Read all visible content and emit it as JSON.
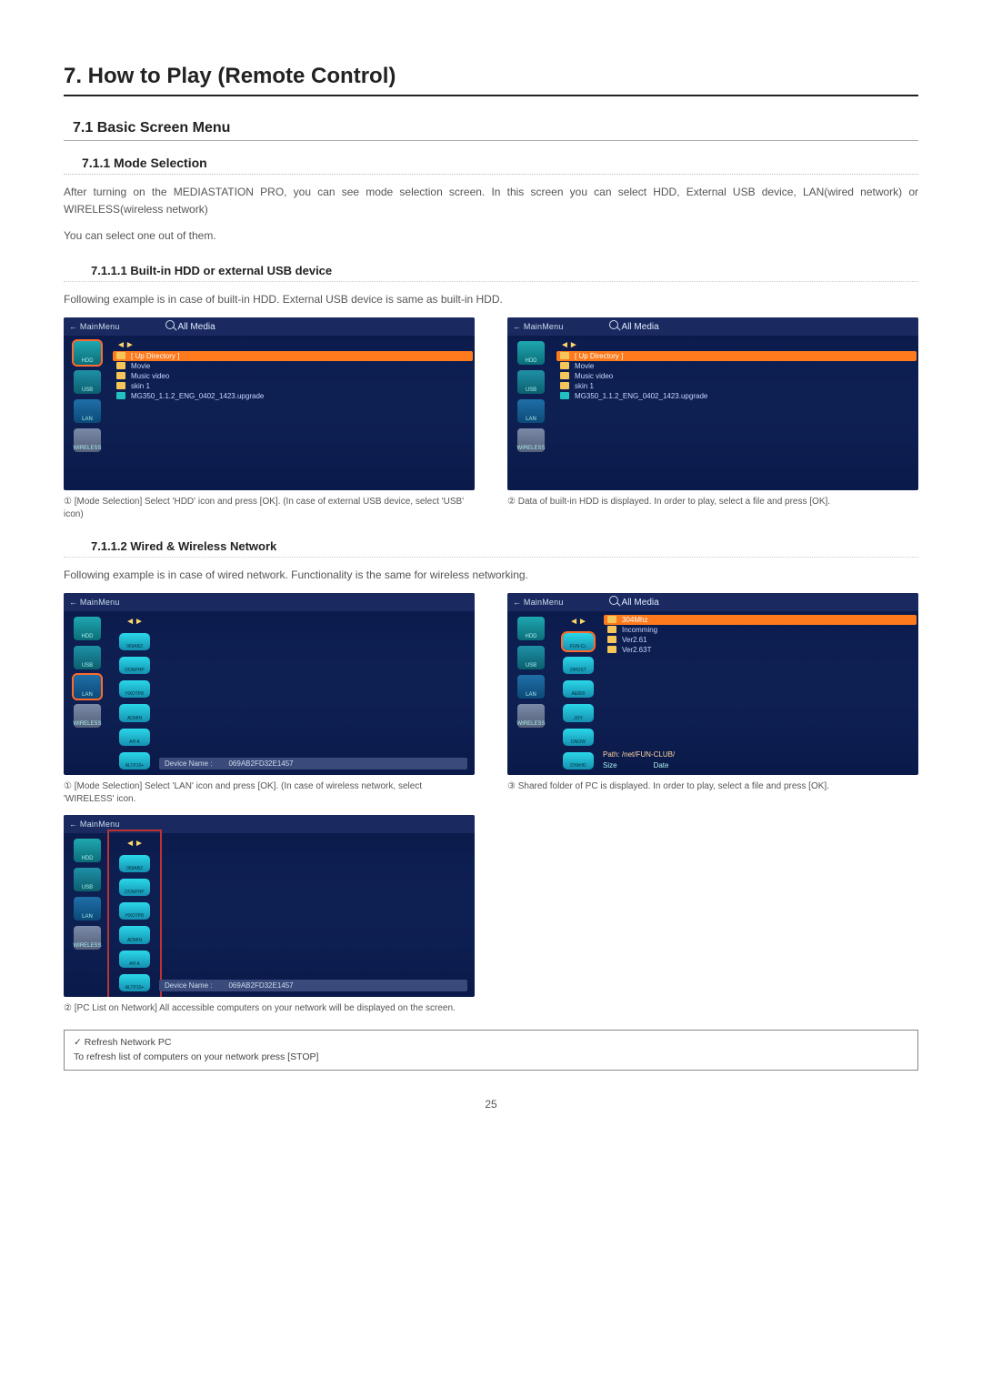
{
  "page_number": "25",
  "chapter_title": "7. How to Play (Remote Control)",
  "section_7_1": "7.1 Basic Screen Menu",
  "section_7_1_1": "7.1.1 Mode Selection",
  "para_7_1_1_a": "After turning on the MEDIASTATION PRO, you can see mode selection screen. In this screen you can select HDD, External USB device, LAN(wired network) or WIRELESS(wireless network)",
  "para_7_1_1_b": "You can select one out of them.",
  "section_7_1_1_1": "7.1.1.1 Built-in HDD or external USB device",
  "para_7_1_1_1": "Following example is in case of built-in HDD. External USB device is same as built-in HDD.",
  "section_7_1_1_2": "7.1.1.2 Wired & Wireless Network",
  "para_7_1_1_2": "Following example is in case of wired network. Functionality is the same for wireless networking.",
  "captions": {
    "hdd_1": "① [Mode Selection] Select 'HDD' icon and press [OK]. (In case of external USB device, select 'USB' icon)",
    "hdd_2": "② Data of built-in HDD is displayed. In order to play, select a file and press [OK].",
    "net_1": "① [Mode Selection] Select 'LAN' icon and press [OK]. (In case of wireless network, select 'WIRELESS' icon.",
    "net_2": "② [PC List on Network] All accessible computers on your network will be displayed on the screen.",
    "net_3": "③ Shared folder of PC is displayed. In order to play, select a file and press [OK]."
  },
  "notebox": {
    "line1": "Refresh Network PC",
    "line2": "To refresh list of computers on your network press [STOP]"
  },
  "screenshots": {
    "common": {
      "main_menu": "← MainMenu",
      "all_media": "All Media",
      "side_labels": {
        "hdd": "HDD",
        "usb": "USB",
        "lan": "LAN",
        "wireless": "WIRELESS"
      }
    },
    "hdd_list": {
      "rows": [
        {
          "type": "updir",
          "label": "[ Up Directory ]"
        },
        {
          "type": "folder",
          "label": "Movie"
        },
        {
          "type": "folder",
          "label": "Music video"
        },
        {
          "type": "folder",
          "label": "skin 1"
        },
        {
          "type": "file",
          "label": "MG350_1.1.2_ENG_0402_1423.upgrade"
        }
      ]
    },
    "net_devname": {
      "label": "Device Name :",
      "value": "069AB2FD32E1457",
      "pcs": [
        "069AB2  ",
        "DONPHP",
        "HXDTP8",
        "ADMIN",
        "AH A",
        "ALTP10+"
      ]
    },
    "shared_folder": {
      "pcs_mid": [
        "FUN-CL",
        "DHOST",
        "AE800",
        "JOY",
        "DNOW",
        "DYAHO"
      ],
      "rows": [
        {
          "label": "304Mhz"
        },
        {
          "label": "Incomming"
        },
        {
          "label": "Ver2.61"
        },
        {
          "label": "Ver2.63T"
        }
      ],
      "path_label": "Path:",
      "path_value": "/net/FUN-CLUB/",
      "size_label": "Size",
      "date_label": "Date"
    }
  }
}
